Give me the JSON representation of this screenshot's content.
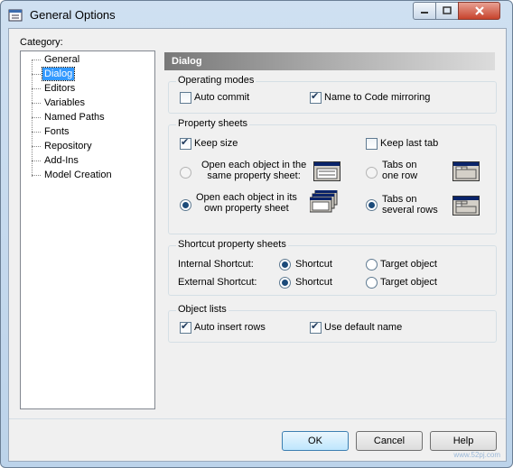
{
  "window": {
    "title": "General Options"
  },
  "category": {
    "label": "Category:",
    "items": [
      "General",
      "Dialog",
      "Editors",
      "Variables",
      "Named Paths",
      "Fonts",
      "Repository",
      "Add-Ins",
      "Model Creation"
    ],
    "selected": "Dialog"
  },
  "panel": {
    "header": "Dialog"
  },
  "operating_modes": {
    "title": "Operating modes",
    "auto_commit": {
      "label": "Auto commit",
      "checked": false
    },
    "name_to_code": {
      "label": "Name to Code mirroring",
      "checked": true
    }
  },
  "property_sheets": {
    "title": "Property sheets",
    "keep_size": {
      "label": "Keep size",
      "checked": true
    },
    "keep_last_tab": {
      "label": "Keep last tab",
      "checked": false
    },
    "open_same_line1": "Open each object in the",
    "open_same_line2": "same property sheet:",
    "open_own_line1": "Open each object in its",
    "open_own_line2": "own property sheet",
    "tabs_one_line1": "Tabs on",
    "tabs_one_line2": "one row",
    "tabs_several_line1": "Tabs on",
    "tabs_several_line2": "several rows"
  },
  "shortcut_sheets": {
    "title": "Shortcut property sheets",
    "internal": "Internal Shortcut:",
    "external": "External Shortcut:",
    "shortcut": "Shortcut",
    "target": "Target object"
  },
  "object_lists": {
    "title": "Object lists",
    "auto_insert": {
      "label": "Auto insert rows",
      "checked": true
    },
    "default_name": {
      "label": "Use default name",
      "checked": true
    }
  },
  "buttons": {
    "ok": "OK",
    "cancel": "Cancel",
    "help": "Help"
  },
  "watermark": "www.52pj.com"
}
